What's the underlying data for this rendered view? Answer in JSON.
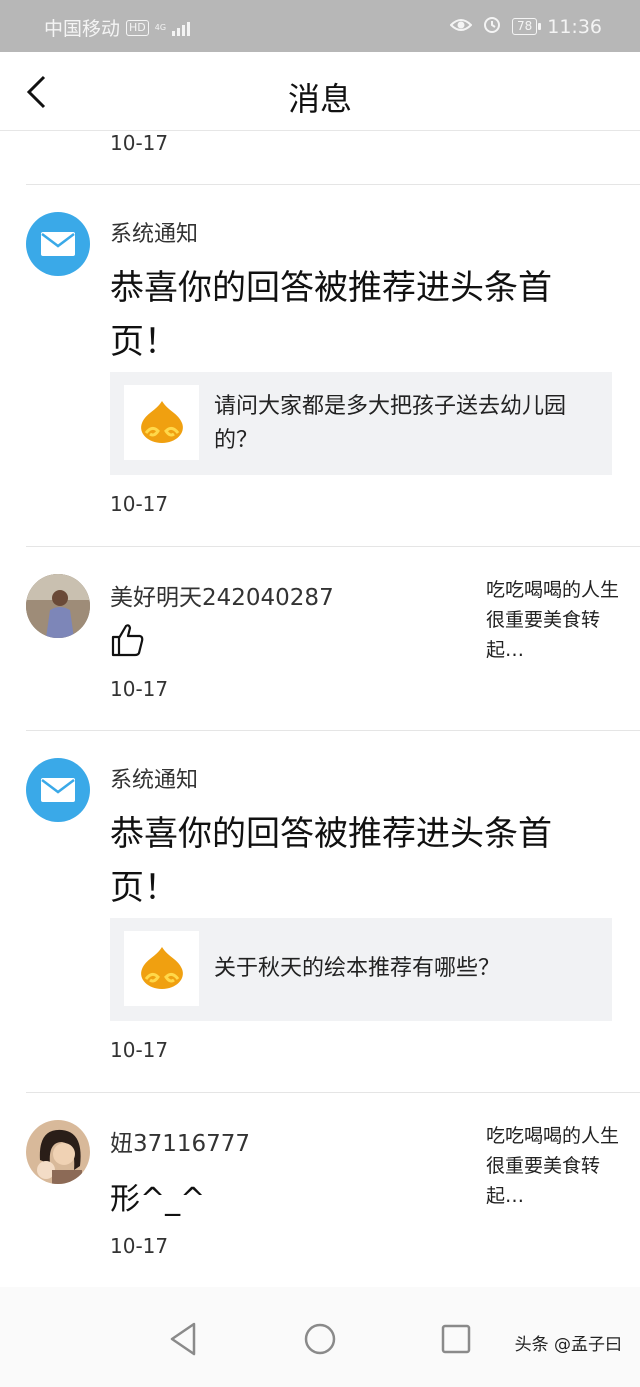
{
  "status_bar": {
    "carrier": "中国移动",
    "hd": "HD",
    "network": "4G",
    "battery": "78",
    "time": "11:36"
  },
  "header": {
    "title": "消息",
    "back_icon": "chevron-left-icon"
  },
  "items": [
    {
      "date": "10-17"
    },
    {
      "sender": "系统通知",
      "headline": "恭喜你的回答被推荐进头条首页！",
      "question": "请问大家都是多大把孩子送去幼儿园的？",
      "date": "10-17"
    },
    {
      "user": "美好明天242040287",
      "side_text": "吃吃喝喝的人生很重要美食转起…",
      "date": "10-17"
    },
    {
      "sender": "系统通知",
      "headline": "恭喜你的回答被推荐进头条首页！",
      "question": "关于秋天的绘本推荐有哪些？",
      "date": "10-17"
    },
    {
      "user": "妞37116777",
      "comment": "形^_^",
      "side_text": "吃吃喝喝的人生很重要美食转起…",
      "date": "10-17"
    }
  ],
  "watermark": "头条 @孟子曰",
  "colors": {
    "accent": "#3aa9e8",
    "card_bg": "#f1f2f4",
    "status_bar": "#b7b7b7"
  }
}
